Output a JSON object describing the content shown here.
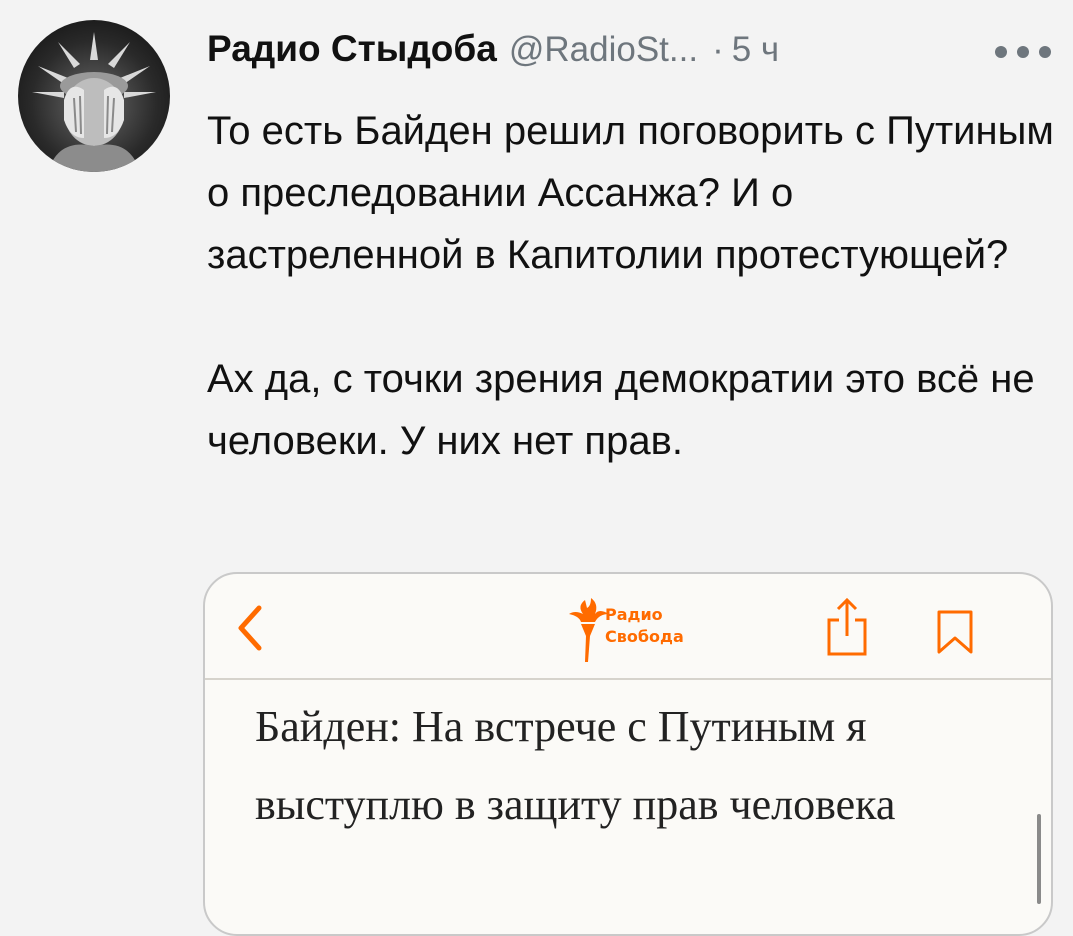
{
  "tweet": {
    "author_name": "Радио Стыдоба",
    "handle": "@RadioSt...",
    "separator": "·",
    "time": "5 ч",
    "paragraph_1": "То есть Байден решил поговорить с Путиным о преследовании Ассанжа? И о застреленной в Капитолии протестующей?",
    "paragraph_2": "Ах да, с точки зрения демократии это всё не человеки. У них нет прав."
  },
  "icons": {
    "more": "more-horizontal-icon",
    "back": "chevron-left-icon",
    "share": "share-icon",
    "bookmark": "bookmark-icon"
  },
  "card": {
    "logo_line_1": "Радио",
    "logo_line_2": "Свобода",
    "headline": "Байден: На встрече с Путиным я выступлю в защиту прав человека"
  },
  "colors": {
    "background": "#f3f3f3",
    "text": "#111111",
    "muted": "#6e767d",
    "brand_orange": "#ff6b00"
  }
}
